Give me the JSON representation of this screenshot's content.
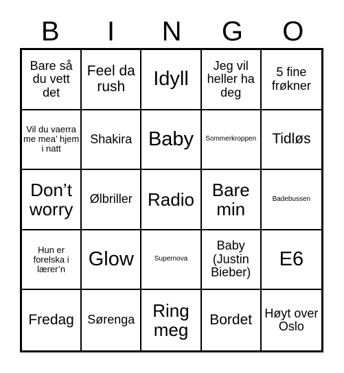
{
  "card": {
    "title": "Bingo Card",
    "header_letters": [
      "B",
      "I",
      "N",
      "G",
      "O"
    ],
    "grid": {
      "rows": 5,
      "columns": 5,
      "cells": [
        {
          "text": "Bare så du vett det",
          "size": "m"
        },
        {
          "text": "Feel da rush",
          "size": "l"
        },
        {
          "text": "Idyll",
          "size": "xxl"
        },
        {
          "text": "Jeg vil heller ha deg",
          "size": "m"
        },
        {
          "text": "5 fine frøkner",
          "size": "m"
        },
        {
          "text": "Vil du vaerra me mea’ hjem i natt",
          "size": "xs"
        },
        {
          "text": "Shakira",
          "size": "m"
        },
        {
          "text": "Baby",
          "size": "xxl"
        },
        {
          "text": "Sommerkroppen",
          "size": "xxs"
        },
        {
          "text": "Tidløs",
          "size": "l"
        },
        {
          "text": "Don’t worry",
          "size": "xl"
        },
        {
          "text": "Ølbriller",
          "size": "m"
        },
        {
          "text": "Radio",
          "size": "xl"
        },
        {
          "text": "Bare min",
          "size": "xl"
        },
        {
          "text": "Badebussen",
          "size": "xxs"
        },
        {
          "text": "Hun er forelska i lærer’n",
          "size": "xs"
        },
        {
          "text": "Glow",
          "size": "xxl"
        },
        {
          "text": "Supernova",
          "size": "xxs"
        },
        {
          "text": "Baby (Justin Bieber)",
          "size": "m"
        },
        {
          "text": "E6",
          "size": "xxl"
        },
        {
          "text": "Fredag",
          "size": "l"
        },
        {
          "text": "Sørenga",
          "size": "m"
        },
        {
          "text": "Ring meg",
          "size": "xl"
        },
        {
          "text": "Bordet",
          "size": "l"
        },
        {
          "text": "Høyt over Oslo",
          "size": "m"
        }
      ]
    },
    "colors": {
      "background": "#ffffff",
      "text": "#000000",
      "grid_line": "#000000"
    }
  }
}
